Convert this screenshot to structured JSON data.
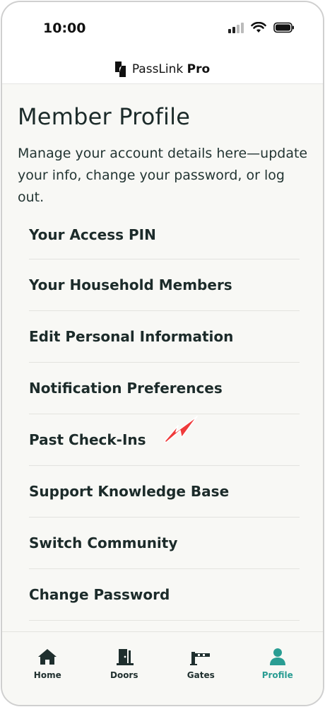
{
  "status_bar": {
    "time": "10:00"
  },
  "brand": {
    "name": "PassLink",
    "tier": "Pro"
  },
  "page": {
    "title": "Member Profile",
    "description": "Manage your account details here—update your info, change your password, or log out."
  },
  "menu": {
    "items": [
      {
        "label": "Your Access PIN"
      },
      {
        "label": "Your Household Members"
      },
      {
        "label": "Edit Personal Information"
      },
      {
        "label": "Notification Preferences"
      },
      {
        "label": "Past Check-Ins"
      },
      {
        "label": "Support Knowledge Base"
      },
      {
        "label": "Switch Community"
      },
      {
        "label": "Change Password"
      }
    ]
  },
  "tab_bar": {
    "tabs": [
      {
        "label": "Home",
        "icon": "home-icon"
      },
      {
        "label": "Doors",
        "icon": "door-icon"
      },
      {
        "label": "Gates",
        "icon": "gate-icon"
      },
      {
        "label": "Profile",
        "icon": "profile-icon"
      }
    ],
    "active": "Profile"
  },
  "colors": {
    "accent": "#2a9d93",
    "arrow": "#ef3b3b",
    "text": "#1c2b2a"
  }
}
